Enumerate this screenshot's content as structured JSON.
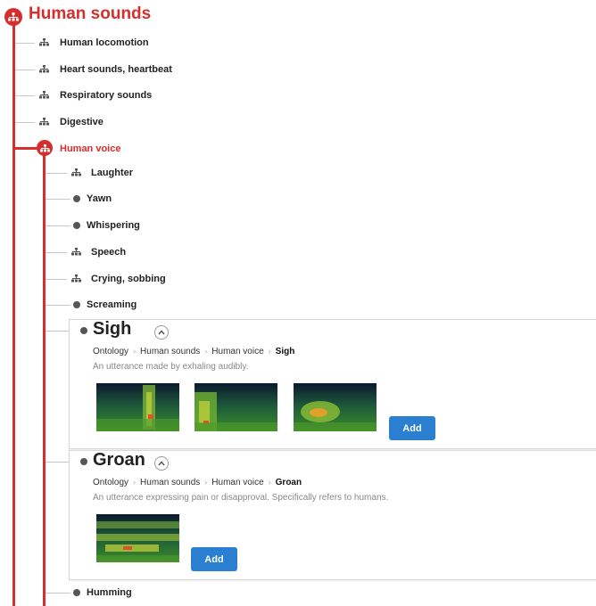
{
  "tree": {
    "root_label": "Human sounds",
    "children": [
      {
        "label": "Human locomotion",
        "icon": "hierarchy-icon"
      },
      {
        "label": "Heart sounds, heartbeat",
        "icon": "hierarchy-icon"
      },
      {
        "label": "Respiratory sounds",
        "icon": "hierarchy-icon"
      },
      {
        "label": "Digestive",
        "icon": "hierarchy-icon"
      },
      {
        "label": "Human voice",
        "icon": "hierarchy-icon",
        "expanded": true
      }
    ],
    "voice_children": [
      {
        "label": "Laughter",
        "icon": "hierarchy-icon"
      },
      {
        "label": "Yawn",
        "icon": "leaf-dot-icon"
      },
      {
        "label": "Whispering",
        "icon": "leaf-dot-icon"
      },
      {
        "label": "Speech",
        "icon": "hierarchy-icon"
      },
      {
        "label": "Crying, sobbing",
        "icon": "hierarchy-icon"
      },
      {
        "label": "Screaming",
        "icon": "leaf-dot-icon"
      }
    ],
    "after_cards": {
      "label": "Humming",
      "icon": "leaf-dot-icon"
    }
  },
  "cards": [
    {
      "title": "Sigh",
      "breadcrumb": [
        "Ontology",
        "Human sounds",
        "Human voice",
        "Sigh"
      ],
      "description": "An utterance made by exhaling audibly.",
      "add_label": "Add"
    },
    {
      "title": "Groan",
      "breadcrumb": [
        "Ontology",
        "Human sounds",
        "Human voice",
        "Groan"
      ],
      "description": "An utterance expressing pain or disapproval. Specifically refers to humans.",
      "add_label": "Add"
    }
  ],
  "colors": {
    "accent": "#d62d2d",
    "button": "#2b7fd0",
    "leaf_dot": "#555555"
  }
}
